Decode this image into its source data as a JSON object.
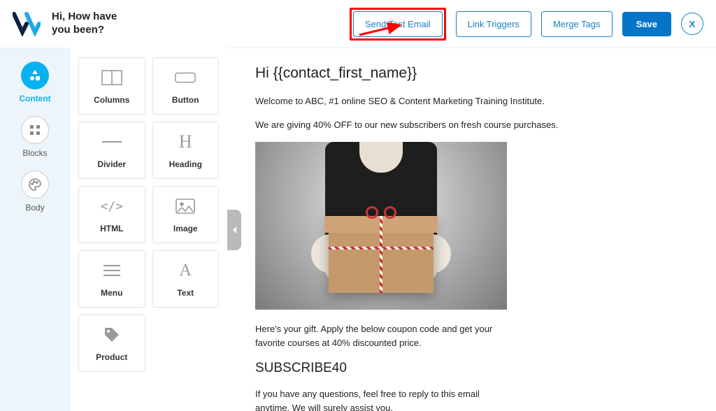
{
  "header": {
    "greeting_line1": "Hi, How have",
    "greeting_line2": "you been?",
    "send_test": "Send Test Email",
    "link_triggers": "Link Triggers",
    "merge_tags": "Merge Tags",
    "save": "Save",
    "close": "X"
  },
  "sidebar": {
    "content": "Content",
    "blocks": "Blocks",
    "body": "Body"
  },
  "components": {
    "columns": "Columns",
    "button": "Button",
    "divider": "Divider",
    "heading": "Heading",
    "html": "HTML",
    "image": "Image",
    "menu": "Menu",
    "text": "Text",
    "product": "Product"
  },
  "email": {
    "heading": "Hi {{contact_first_name}}",
    "intro1": "Welcome to ABC, #1 online SEO & Content Marketing Training Institute.",
    "intro2": "We are giving 40% OFF to our new subscribers on fresh course purchases.",
    "gift_text": "Here's your gift. Apply the below coupon code and get your favorite courses at 40% discounted price.",
    "coupon": "SUBSCRIBE40",
    "support": "If you have any questions, feel free to reply to this email anytime. We will surely assist you."
  }
}
